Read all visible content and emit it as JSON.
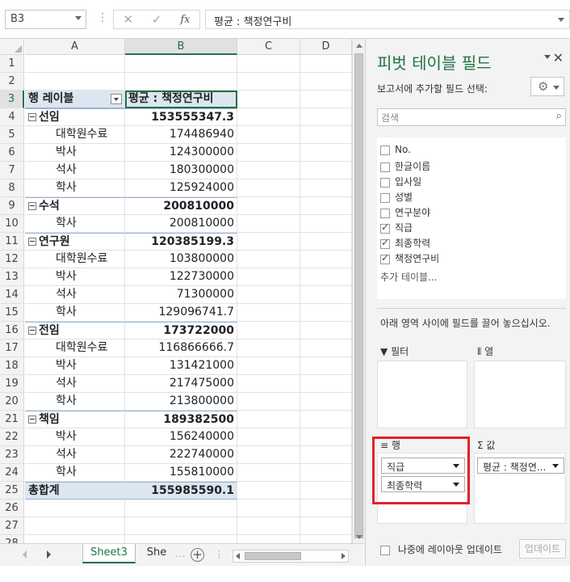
{
  "formula_bar": {
    "name_box": "B3",
    "cancel_icon": "✕",
    "enter_icon": "✓",
    "fx_label": "fx",
    "formula": "평균 : 책정연구비"
  },
  "columns": [
    "A",
    "B",
    "C",
    "D"
  ],
  "selected_cell": "B3",
  "rows": [
    {
      "num": "1",
      "a": "",
      "b": "",
      "type": "blank"
    },
    {
      "num": "2",
      "a": "",
      "b": "",
      "type": "blank"
    },
    {
      "num": "3",
      "a": "행 레이블",
      "b": "평균 : 책정연구비",
      "type": "header"
    },
    {
      "num": "4",
      "a": "선임",
      "b": "153555347.3",
      "type": "group"
    },
    {
      "num": "5",
      "a": "대학원수료",
      "b": "174486940",
      "type": "item"
    },
    {
      "num": "6",
      "a": "박사",
      "b": "124300000",
      "type": "item"
    },
    {
      "num": "7",
      "a": "석사",
      "b": "180300000",
      "type": "item"
    },
    {
      "num": "8",
      "a": "학사",
      "b": "125924000",
      "type": "item"
    },
    {
      "num": "9",
      "a": "수석",
      "b": "200810000",
      "type": "group"
    },
    {
      "num": "10",
      "a": "학사",
      "b": "200810000",
      "type": "item"
    },
    {
      "num": "11",
      "a": "연구원",
      "b": "120385199.3",
      "type": "group"
    },
    {
      "num": "12",
      "a": "대학원수료",
      "b": "103800000",
      "type": "item"
    },
    {
      "num": "13",
      "a": "박사",
      "b": "122730000",
      "type": "item"
    },
    {
      "num": "14",
      "a": "석사",
      "b": "71300000",
      "type": "item"
    },
    {
      "num": "15",
      "a": "학사",
      "b": "129096741.7",
      "type": "item"
    },
    {
      "num": "16",
      "a": "전임",
      "b": "173722000",
      "type": "group"
    },
    {
      "num": "17",
      "a": "대학원수료",
      "b": "116866666.7",
      "type": "item"
    },
    {
      "num": "18",
      "a": "박사",
      "b": "131421000",
      "type": "item"
    },
    {
      "num": "19",
      "a": "석사",
      "b": "217475000",
      "type": "item"
    },
    {
      "num": "20",
      "a": "학사",
      "b": "213800000",
      "type": "item"
    },
    {
      "num": "21",
      "a": "책임",
      "b": "189382500",
      "type": "group"
    },
    {
      "num": "22",
      "a": "박사",
      "b": "156240000",
      "type": "item"
    },
    {
      "num": "23",
      "a": "석사",
      "b": "222740000",
      "type": "item"
    },
    {
      "num": "24",
      "a": "학사",
      "b": "155810000",
      "type": "item"
    },
    {
      "num": "25",
      "a": "총합계",
      "b": "155985590.1",
      "type": "total"
    },
    {
      "num": "26",
      "a": "",
      "b": "",
      "type": "blank"
    },
    {
      "num": "27",
      "a": "",
      "b": "",
      "type": "blank"
    },
    {
      "num": "28",
      "a": "",
      "b": "",
      "type": "blank"
    }
  ],
  "sheet_tabs": {
    "active": "Sheet3",
    "other": "She",
    "dots": "...",
    "add": "+"
  },
  "pivot_pane": {
    "title": "피벗 테이블 필드",
    "subtitle": "보고서에 추가할 필드 선택:",
    "search_placeholder": "검색",
    "fields": [
      {
        "label": "No.",
        "checked": false
      },
      {
        "label": "한글이름",
        "checked": false
      },
      {
        "label": "입사일",
        "checked": false
      },
      {
        "label": "성별",
        "checked": false
      },
      {
        "label": "연구분야",
        "checked": false
      },
      {
        "label": "직급",
        "checked": true
      },
      {
        "label": "최종학력",
        "checked": true
      },
      {
        "label": "책정연구비",
        "checked": true
      }
    ],
    "more_tables": "추가 테이블...",
    "drag_hint": "아래 영역 사이에 필드를 끌어 놓으십시오.",
    "areas": {
      "filter": "필터",
      "columns": "열",
      "rows": "행",
      "values": "값"
    },
    "row_fields": [
      "직급",
      "최종학력"
    ],
    "value_fields": [
      "평균 : 책정연..."
    ],
    "defer_label": "나중에 레이아웃 업데이트",
    "update_button": "업데이트"
  },
  "colors": {
    "accent": "#217346",
    "pivot_header": "#dce6f1",
    "highlight": "#e0232b"
  }
}
